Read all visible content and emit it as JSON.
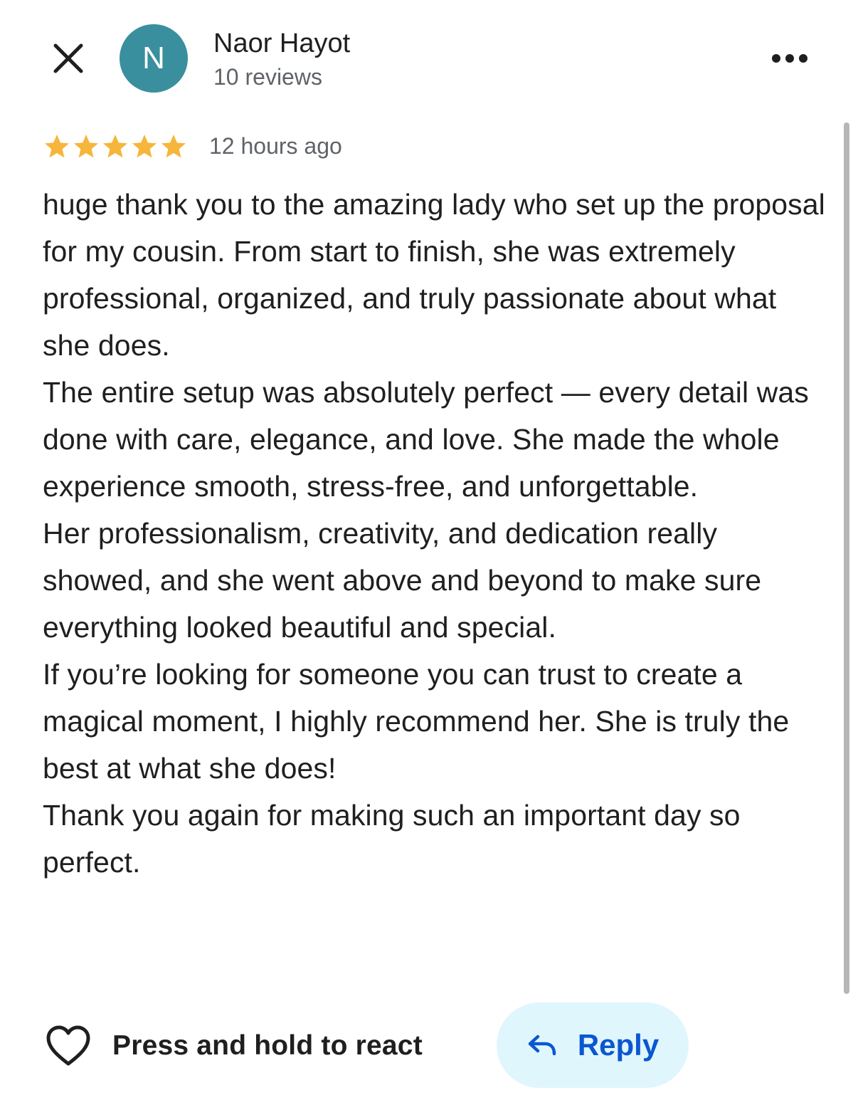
{
  "header": {
    "close_icon": "close-icon",
    "avatar_letter": "N",
    "avatar_color": "#3a8f9e",
    "reviewer_name": "Naor Hayot",
    "review_count": "10 reviews",
    "more_icon": "more-options-icon"
  },
  "review": {
    "rating": 5,
    "rating_max": 5,
    "star_color": "#f6b63b",
    "time_ago": "12 hours ago",
    "body": "huge thank you to the amazing lady who set up the proposal for my cousin. From start to finish, she was extremely professional, organized, and truly passionate about what she does.\nThe entire setup was absolutely perfect — every detail was done with care, elegance, and love. She made the whole experience smooth, stress-free, and unforgettable.\nHer professionalism, creativity, and dedication really showed, and she went above and beyond to make sure everything looked beautiful and special.\nIf you’re looking for someone you can trust to create a magical moment, I highly recommend her. She is truly the best at what she does!\nThank you again for making such an important day so perfect."
  },
  "footer": {
    "react_icon": "heart-icon",
    "react_label": "Press and hold to react",
    "reply_icon": "reply-arrow-icon",
    "reply_label": "Reply",
    "reply_bg_color": "#e0f6fd",
    "reply_text_color": "#0b57d0"
  }
}
